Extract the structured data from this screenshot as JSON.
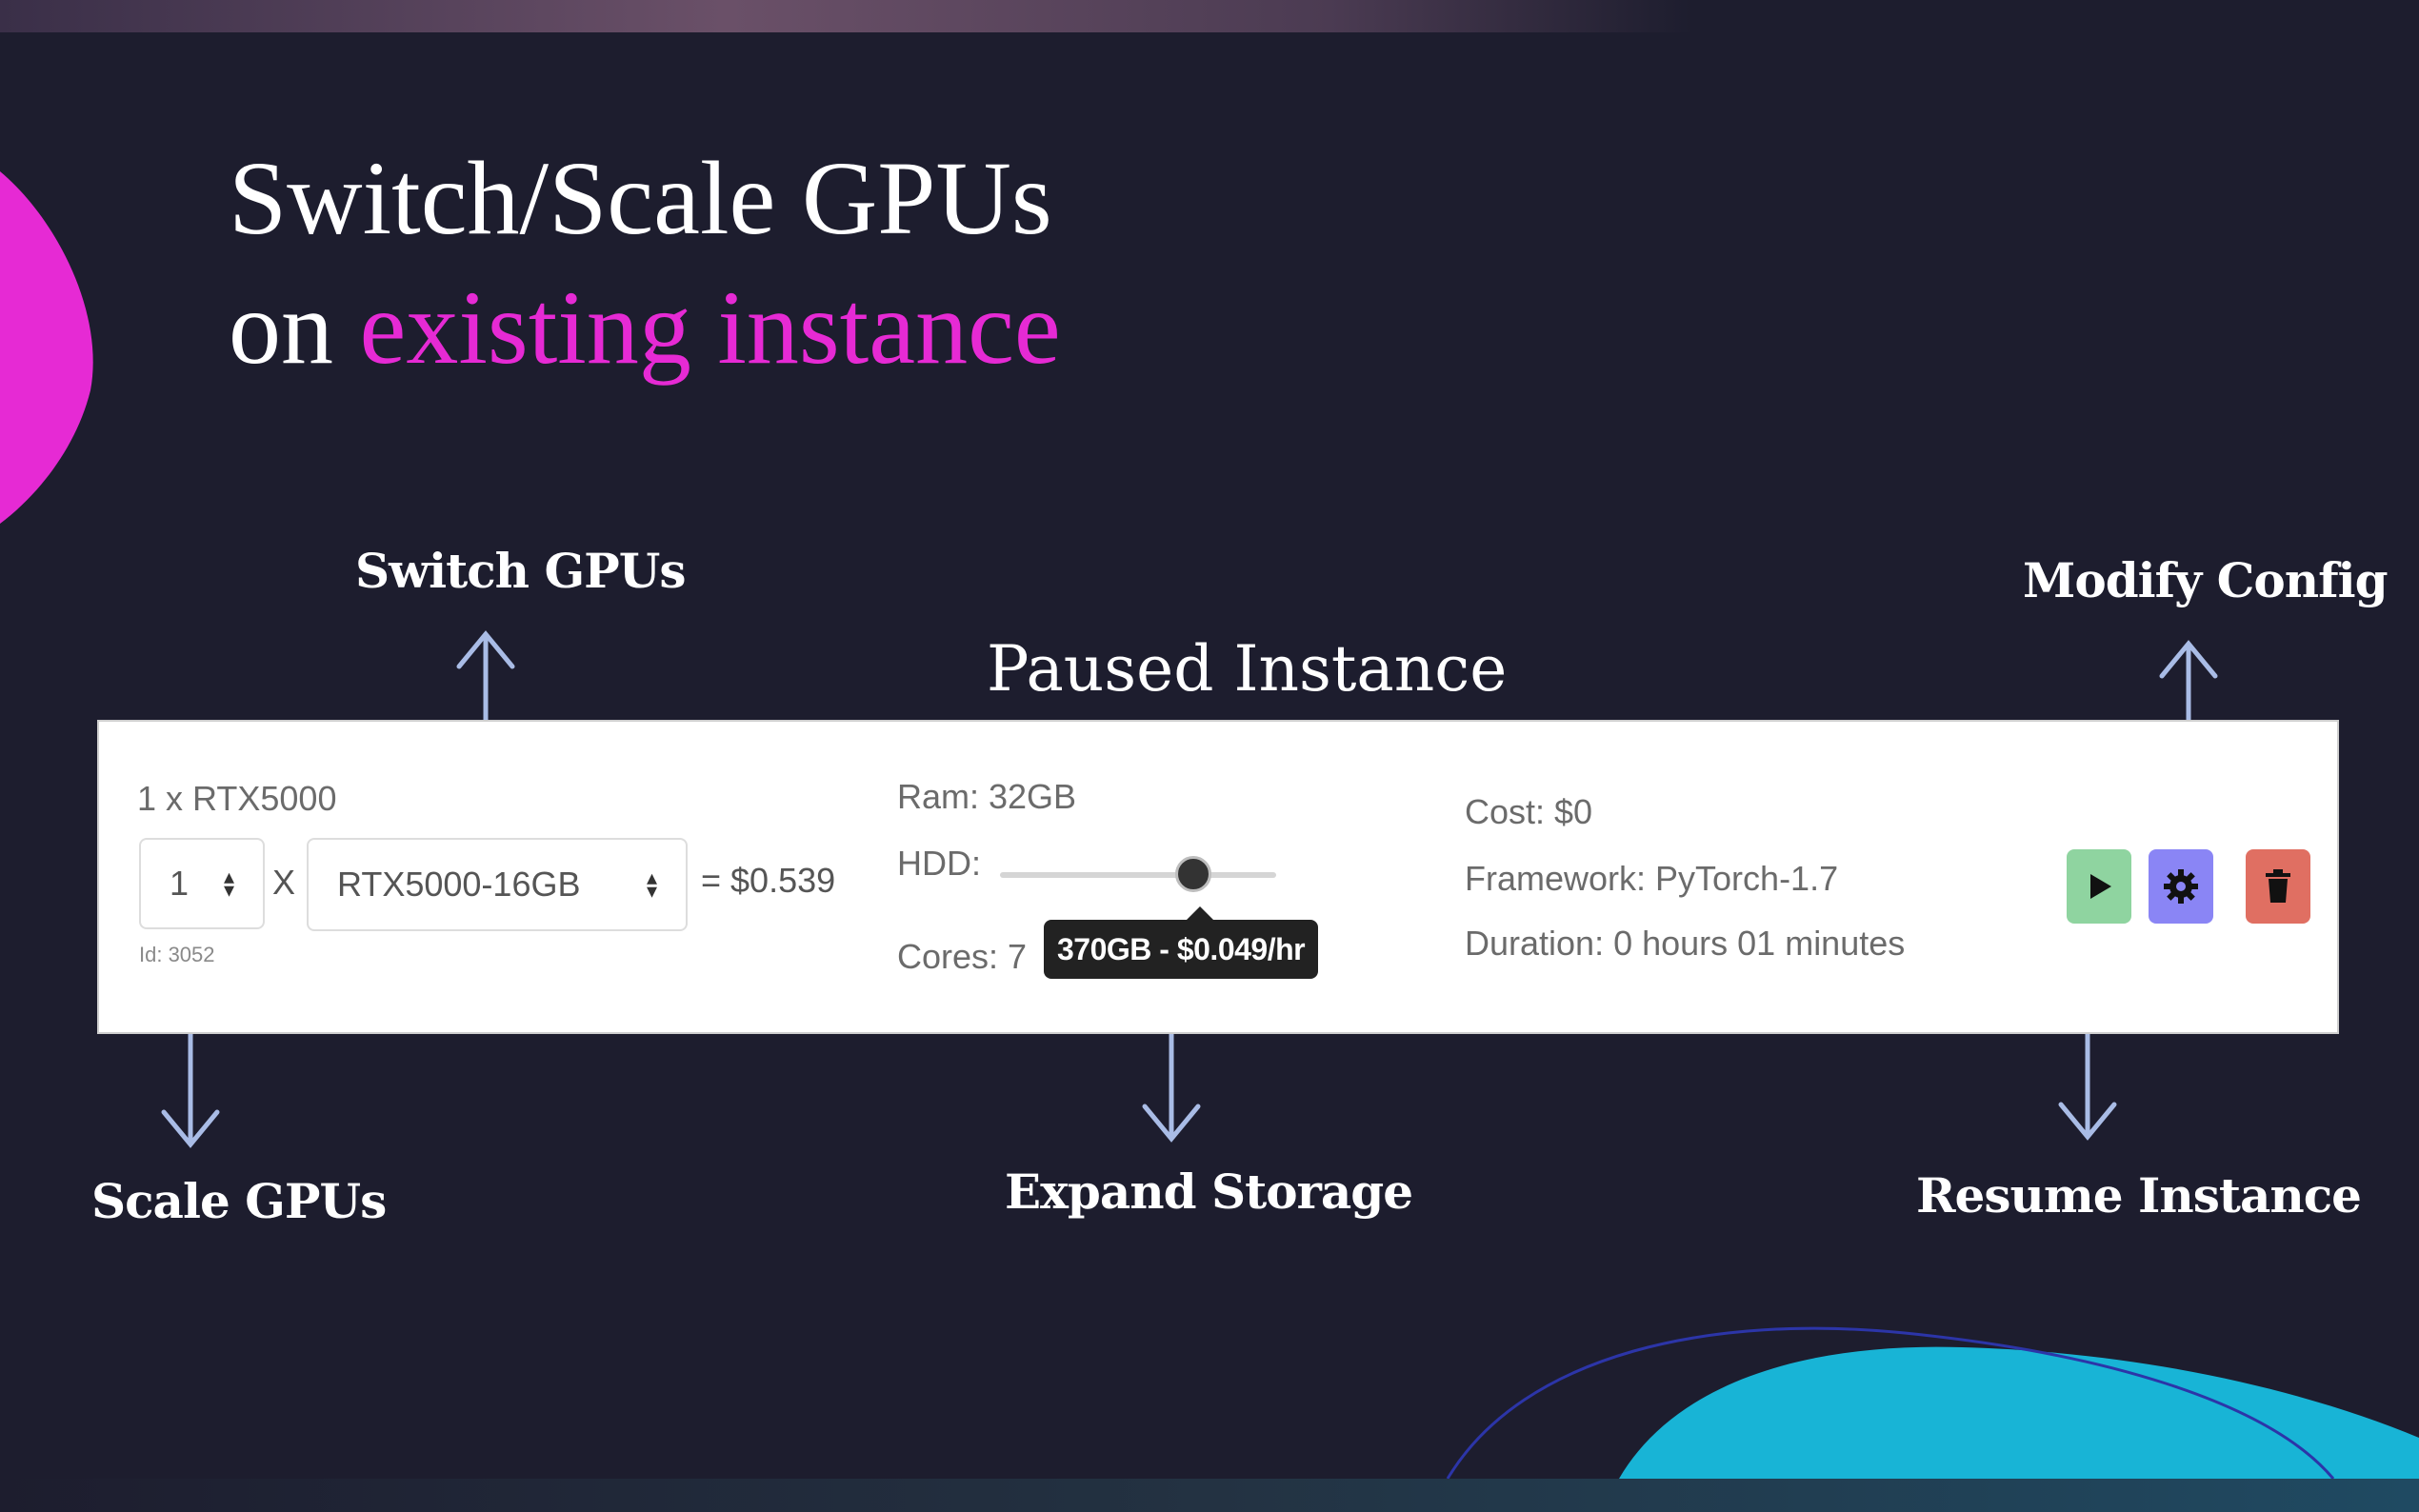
{
  "slide": {
    "title_line1": "Switch/Scale GPUs",
    "title_line2_prefix": "on ",
    "title_line2_highlight": "existing instance",
    "card_heading": "Paused Instance"
  },
  "annotations": {
    "switch_gpus": "Switch GPUs",
    "modify_config": "Modify Config",
    "scale_gpus": "Scale GPUs",
    "expand_storage": "Expand Storage",
    "resume_instance": "Resume Instance"
  },
  "instance": {
    "summary": "1 x RTX5000",
    "gpu_count": "1",
    "multiply": "X",
    "gpu_type": "RTX5000-16GB",
    "price": "= $0.539",
    "id": "Id: 3052",
    "ram": "Ram: 32GB",
    "hdd_label": "HDD:",
    "cores": "Cores: 7",
    "hdd_tooltip": "370GB - $0.049/hr",
    "hdd_slider_fraction": 0.7,
    "cost": "Cost: $0",
    "framework": "Framework: PyTorch-1.7",
    "duration": "Duration: 0 hours 01 minutes"
  },
  "buttons": {
    "resume": {
      "icon": "play-icon",
      "color": "#8fd4a0"
    },
    "config": {
      "icon": "gear-icon",
      "color": "#8a85f5"
    },
    "delete": {
      "icon": "trash-icon",
      "color": "#e06f62"
    }
  },
  "colors": {
    "background": "#1d1d2e",
    "highlight": "#e62ad4",
    "arrow": "#a9bce6",
    "blob_teal": "#18b4d6"
  }
}
